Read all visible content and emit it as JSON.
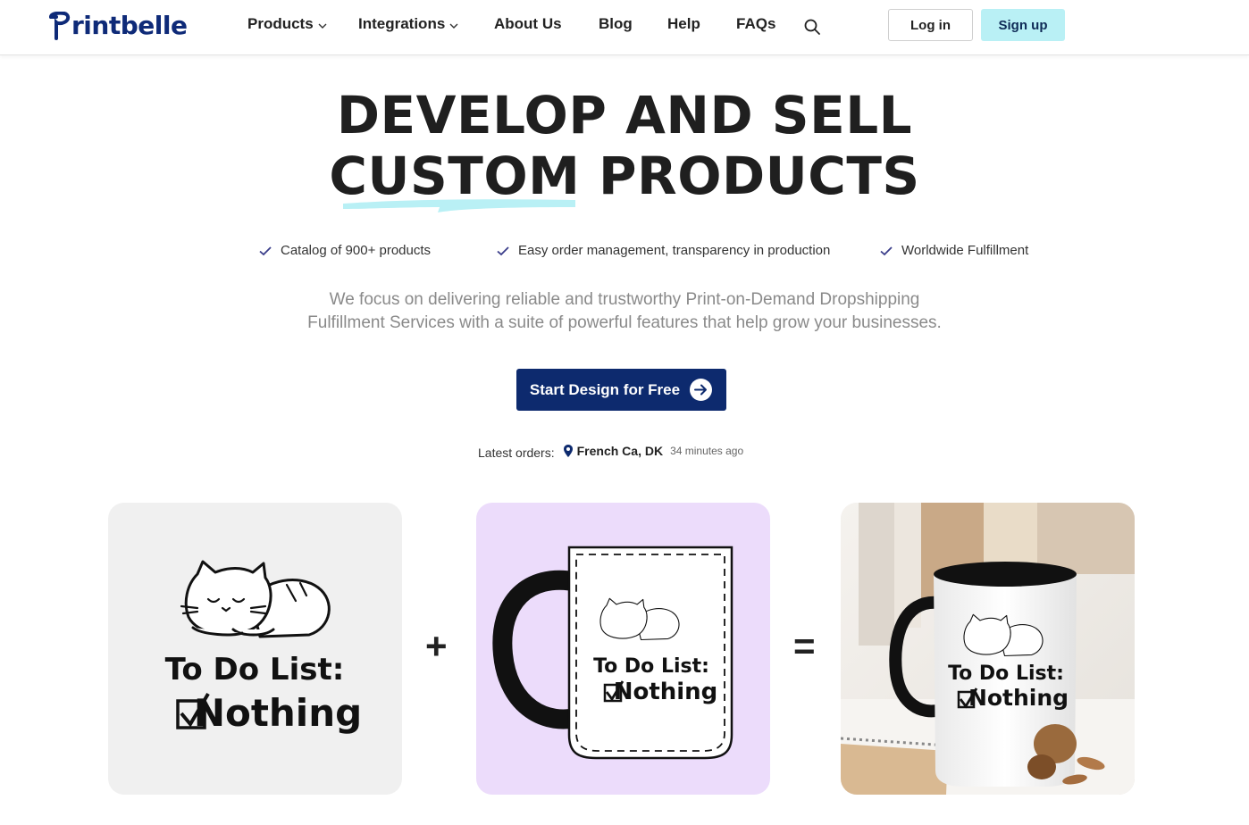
{
  "brand": {
    "name": "Printbelle",
    "logo_text": "rintbelle",
    "logo_initial": "P",
    "color": "#0e2a78"
  },
  "nav": {
    "items": [
      {
        "label": "Products",
        "dropdown": true
      },
      {
        "label": "Integrations",
        "dropdown": true
      },
      {
        "label": "About Us",
        "dropdown": false
      },
      {
        "label": "Blog",
        "dropdown": false
      },
      {
        "label": "Help",
        "dropdown": false
      },
      {
        "label": "FAQs",
        "dropdown": false
      }
    ],
    "search_icon": "search-icon",
    "login_label": "Log in",
    "signup_label": "Sign up"
  },
  "hero": {
    "title_line1": "DEVELOP AND SELL",
    "title_line2": "CUSTOM PRODUCTS",
    "features": [
      "Catalog of 900+ products",
      "Easy order management, transparency in production",
      "Worldwide Fulfillment"
    ],
    "subtitle_line1": "We focus on delivering reliable and trustworthy Print-on-Demand Dropshipping",
    "subtitle_line2": "Fulfillment Services with a suite of powerful features that help grow your businesses.",
    "cta_label": "Start Design for Free",
    "latest_label": "Latest orders:",
    "latest_location": "French Ca, DK",
    "latest_time": "34 minutes ago"
  },
  "showcase": {
    "design_line1": "To Do List:",
    "design_line2": "Nothing",
    "operator_plus": "+",
    "operator_equals": "=",
    "colors": {
      "card1": "#f0f0f0",
      "card2": "#ecdcfb",
      "accent": "#b9f0f5",
      "cta": "#0d2a6e"
    }
  }
}
